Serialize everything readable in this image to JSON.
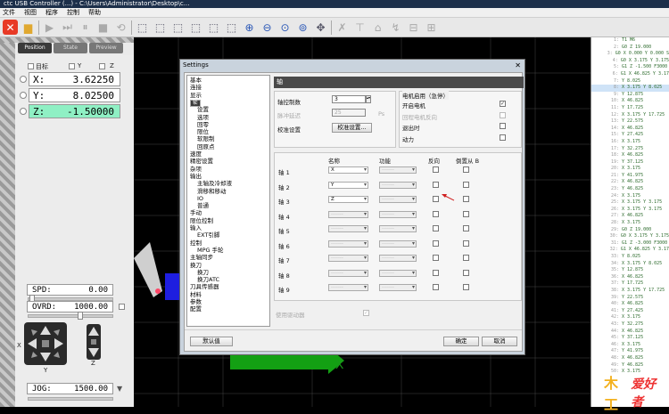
{
  "title": "ctc USB Controller (...) - C:\\Users\\Administrator\\Desktop\\c...",
  "menu": [
    "文件",
    "视图",
    "程序",
    "控制",
    "帮助"
  ],
  "left": {
    "tabs": [
      "Position",
      "State",
      "Preview"
    ],
    "checks": [
      {
        "label": "目标"
      },
      {
        "label": "Y"
      },
      {
        "label": "Z"
      }
    ],
    "axes": [
      {
        "label": "X:",
        "value": "3.62250"
      },
      {
        "label": "Y:",
        "value": "8.02500"
      },
      {
        "label": "Z:",
        "value": "-1.50000"
      }
    ],
    "spd_label": "SPD:",
    "spd_value": "0.00",
    "ovrd_label": "OVRD:",
    "ovrd_value": "1000.00",
    "jog_label": "JOG:",
    "jog_value": "1500.00",
    "jog_axes": {
      "x": "X",
      "y": "Y",
      "z": "Z"
    }
  },
  "gcode": {
    "lines": [
      {
        "n": "1:",
        "t": "T1 M6"
      },
      {
        "n": "2:",
        "t": "G0 Z 19.000"
      },
      {
        "n": "3:",
        "t": "G0 X 0.000 Y 0.000 S"
      },
      {
        "n": "4:",
        "t": "G0 X 3.175 Y 3.175"
      },
      {
        "n": "5:",
        "t": "G1 Z -1.500 F3000"
      },
      {
        "n": "6:",
        "t": "G1 X 46.825 Y 3.17"
      },
      {
        "n": "7:",
        "t": "Y 8.025"
      },
      {
        "n": "8:",
        "t": "X 3.175 Y 8.025",
        "hl": true
      },
      {
        "n": "9:",
        "t": "Y 12.875"
      },
      {
        "n": "10:",
        "t": "X 46.825"
      },
      {
        "n": "11:",
        "t": "Y 17.725"
      },
      {
        "n": "12:",
        "t": "X 3.175 Y 17.725"
      },
      {
        "n": "13:",
        "t": "Y 22.575"
      },
      {
        "n": "14:",
        "t": "X 46.825"
      },
      {
        "n": "15:",
        "t": "Y 27.425"
      },
      {
        "n": "16:",
        "t": "X 3.175"
      },
      {
        "n": "17:",
        "t": "Y 32.275"
      },
      {
        "n": "18:",
        "t": "X 46.825"
      },
      {
        "n": "19:",
        "t": "Y 37.125"
      },
      {
        "n": "20:",
        "t": "X 3.175"
      },
      {
        "n": "21:",
        "t": "Y 41.975"
      },
      {
        "n": "22:",
        "t": "X 46.825"
      },
      {
        "n": "23:",
        "t": "Y 46.825"
      },
      {
        "n": "24:",
        "t": "X 3.175"
      },
      {
        "n": "25:",
        "t": "X 3.175 Y 3.175"
      },
      {
        "n": "26:",
        "t": "X 3.175 Y 3.175"
      },
      {
        "n": "27:",
        "t": "X 46.825"
      },
      {
        "n": "28:",
        "t": "X 3.175"
      },
      {
        "n": "29:",
        "t": "G0 Z 19.000"
      },
      {
        "n": "30:",
        "t": "G0 X 3.175 Y 3.175"
      },
      {
        "n": "31:",
        "t": "G1 Z -3.000 F3000"
      },
      {
        "n": "32:",
        "t": "G1 X 46.825 Y 3.17"
      },
      {
        "n": "33:",
        "t": "Y 8.025"
      },
      {
        "n": "34:",
        "t": "X 3.175 Y 8.025"
      },
      {
        "n": "35:",
        "t": "Y 12.875"
      },
      {
        "n": "36:",
        "t": "X 46.825"
      },
      {
        "n": "37:",
        "t": "Y 17.725"
      },
      {
        "n": "38:",
        "t": "X 3.175 Y 17.725"
      },
      {
        "n": "39:",
        "t": "Y 22.575"
      },
      {
        "n": "40:",
        "t": "X 46.825"
      },
      {
        "n": "41:",
        "t": "Y 27.425"
      },
      {
        "n": "42:",
        "t": "X 3.175"
      },
      {
        "n": "43:",
        "t": "Y 32.275"
      },
      {
        "n": "44:",
        "t": "X 46.825"
      },
      {
        "n": "45:",
        "t": "Y 37.125"
      },
      {
        "n": "46:",
        "t": "X 3.175"
      },
      {
        "n": "47:",
        "t": "Y 41.975"
      },
      {
        "n": "48:",
        "t": "X 46.825"
      },
      {
        "n": "49:",
        "t": "Y 46.825"
      },
      {
        "n": "50:",
        "t": "X 3.175"
      }
    ]
  },
  "dialog": {
    "title": "Settings",
    "tree": [
      {
        "label": "基本",
        "level": 0
      },
      {
        "label": "连接",
        "level": 0
      },
      {
        "label": "显示",
        "level": 0
      },
      {
        "label": "轴",
        "level": 0,
        "selected": true
      },
      {
        "label": "设置",
        "level": 1
      },
      {
        "label": "选项",
        "level": 1
      },
      {
        "label": "回零",
        "level": 1
      },
      {
        "label": "限位",
        "level": 1
      },
      {
        "label": "软限制",
        "level": 1
      },
      {
        "label": "回原点",
        "level": 1
      },
      {
        "label": "速度",
        "level": 0
      },
      {
        "label": "精密设置",
        "level": 0
      },
      {
        "label": "杂项",
        "level": 0
      },
      {
        "label": "输出",
        "level": 0
      },
      {
        "label": "主轴及冷却液",
        "level": 1
      },
      {
        "label": "滑移和移动",
        "level": 1
      },
      {
        "label": "IO",
        "level": 1
      },
      {
        "label": "普通",
        "level": 1
      },
      {
        "label": "手动",
        "level": 0
      },
      {
        "label": "限位控制",
        "level": 0
      },
      {
        "label": "输入",
        "level": 0
      },
      {
        "label": "EXT引脚",
        "level": 1
      },
      {
        "label": "控制",
        "level": 0
      },
      {
        "label": "MPG 手轮",
        "level": 1
      },
      {
        "label": "主轴同步",
        "level": 0
      },
      {
        "label": "换刀",
        "level": 0
      },
      {
        "label": "换刀",
        "level": 1
      },
      {
        "label": "换刀ATC",
        "level": 1
      },
      {
        "label": "刀具传感器",
        "level": 0
      },
      {
        "label": "材料",
        "level": 0
      },
      {
        "label": "参数",
        "level": 0
      },
      {
        "label": "配置",
        "level": 0
      }
    ],
    "panel_title": "轴",
    "axis_count_label": "轴控制数",
    "axis_count_value": "3",
    "backlash_label": "脉冲延迟",
    "backlash_value": "25",
    "backlash_unit": "Ps",
    "calib_label": "校准设置",
    "calib_button": "校准设置...",
    "motor_group_title": "电机启用（急停）",
    "motor_options": [
      {
        "label": "开启电机",
        "checked": true,
        "enabled": true
      },
      {
        "label": "回程电机反向",
        "checked": false,
        "enabled": false
      },
      {
        "label": "退出时",
        "checked": false,
        "enabled": true
      },
      {
        "label": "动力",
        "checked": false,
        "enabled": true
      }
    ],
    "table_headers": {
      "name": "名称",
      "func": "功能",
      "reverse": "反向",
      "slave": "倒置从 B"
    },
    "rows": [
      {
        "label": "轴 1",
        "name": "X",
        "name_enabled": true,
        "func": "-------",
        "rev": false,
        "slave": false
      },
      {
        "label": "轴 2",
        "name": "Y",
        "name_enabled": true,
        "func": "-------",
        "rev": false,
        "slave": false
      },
      {
        "label": "轴 3",
        "name": "Z",
        "name_enabled": true,
        "func": "-------",
        "rev": false,
        "slave": false
      },
      {
        "label": "轴 4",
        "name": "-------",
        "name_enabled": false,
        "func": "-------",
        "rev": false,
        "slave": false
      },
      {
        "label": "轴 5",
        "name": "-------",
        "name_enabled": false,
        "func": "-------",
        "rev": false,
        "slave": false
      },
      {
        "label": "轴 6",
        "name": "-------",
        "name_enabled": false,
        "func": "-------",
        "rev": false,
        "slave": false
      },
      {
        "label": "轴 7",
        "name": "-------",
        "name_enabled": false,
        "func": "-------",
        "rev": false,
        "slave": false
      },
      {
        "label": "轴 8",
        "name": "-------",
        "name_enabled": false,
        "func": "-------",
        "rev": false,
        "slave": false
      },
      {
        "label": "轴 9",
        "name": "-------",
        "name_enabled": false,
        "func": "-------",
        "rev": false,
        "slave": false
      }
    ],
    "bottom_check_label": "使用驱动器",
    "default_button": "默认值",
    "ok_button": "确定",
    "cancel_button": "取消"
  },
  "viewport_axis_label": "X",
  "logo": {
    "part1": "木工",
    "part2": "爱好者"
  }
}
